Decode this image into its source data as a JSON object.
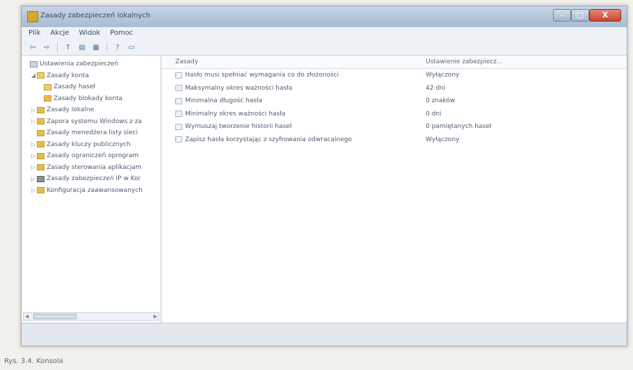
{
  "window": {
    "title": "Zasady zabezpieczeń lokalnych",
    "controls": {
      "minimize": "–",
      "maximize": "□",
      "close": "X"
    }
  },
  "menu": [
    "Plik",
    "Akcje",
    "Widok",
    "Pomoc"
  ],
  "toolbar": [
    {
      "icon": "back-arrow-icon",
      "glyph": "⇦"
    },
    {
      "icon": "forward-arrow-icon",
      "glyph": "⇨"
    },
    {
      "icon": "up-folder-icon",
      "glyph": "↑"
    },
    {
      "icon": "show-hide-tree-icon",
      "glyph": "▤"
    },
    {
      "icon": "export-list-icon",
      "glyph": "▦"
    },
    {
      "icon": "help-icon",
      "glyph": "?"
    },
    {
      "icon": "mmc-pane-icon",
      "glyph": "▭"
    }
  ],
  "tree": [
    {
      "label": "Ustawienia zabezpieczeń",
      "indent": 0,
      "expander": "",
      "icon": "computer"
    },
    {
      "label": "Zasady konta",
      "indent": 1,
      "expander": "◢",
      "icon": "open"
    },
    {
      "label": "Zasady haseł",
      "indent": 2,
      "expander": "",
      "icon": "open"
    },
    {
      "label": "Zasady blokady konta",
      "indent": 2,
      "expander": "",
      "icon": "folder"
    },
    {
      "label": "Zasady lokalne",
      "indent": 1,
      "expander": "▷",
      "icon": "folder"
    },
    {
      "label": "Zapora systemu Windows z za",
      "indent": 1,
      "expander": "▷",
      "icon": "folder"
    },
    {
      "label": "Zasady menedżera listy sieci",
      "indent": 1,
      "expander": "",
      "icon": "folder"
    },
    {
      "label": "Zasady kluczy publicznych",
      "indent": 1,
      "expander": "▷",
      "icon": "folder"
    },
    {
      "label": "Zasady ograniczeń oprogram",
      "indent": 1,
      "expander": "▷",
      "icon": "folder"
    },
    {
      "label": "Zasady sterowania aplikacjam",
      "indent": 1,
      "expander": "▷",
      "icon": "folder"
    },
    {
      "label": "Zasady zabezpieczeń IP w Kor",
      "indent": 1,
      "expander": "▷",
      "icon": "shield"
    },
    {
      "label": "Konfiguracja zaawansowanych",
      "indent": 1,
      "expander": "▷",
      "icon": "folder"
    }
  ],
  "list": {
    "columns": [
      "Zasady",
      "Ustawienie zabezpiecz..."
    ],
    "rows": [
      {
        "policy": "Hasło musi spełniać wymagania co do złożoności",
        "setting": "Wyłączony"
      },
      {
        "policy": "Maksymalny okres ważności hasła",
        "setting": "42 dni"
      },
      {
        "policy": "Minimalna długość hasła",
        "setting": "0 znaków"
      },
      {
        "policy": "Minimalny okres ważności hasła",
        "setting": "0 dni"
      },
      {
        "policy": "Wymuszaj tworzenie historii haseł",
        "setting": "0 pamiętanych haseł"
      },
      {
        "policy": "Zapisz hasła korzystając z szyfrowania odwracalnego",
        "setting": "Wyłączony"
      }
    ]
  },
  "caption": "Rys. 3.4. Konsola"
}
